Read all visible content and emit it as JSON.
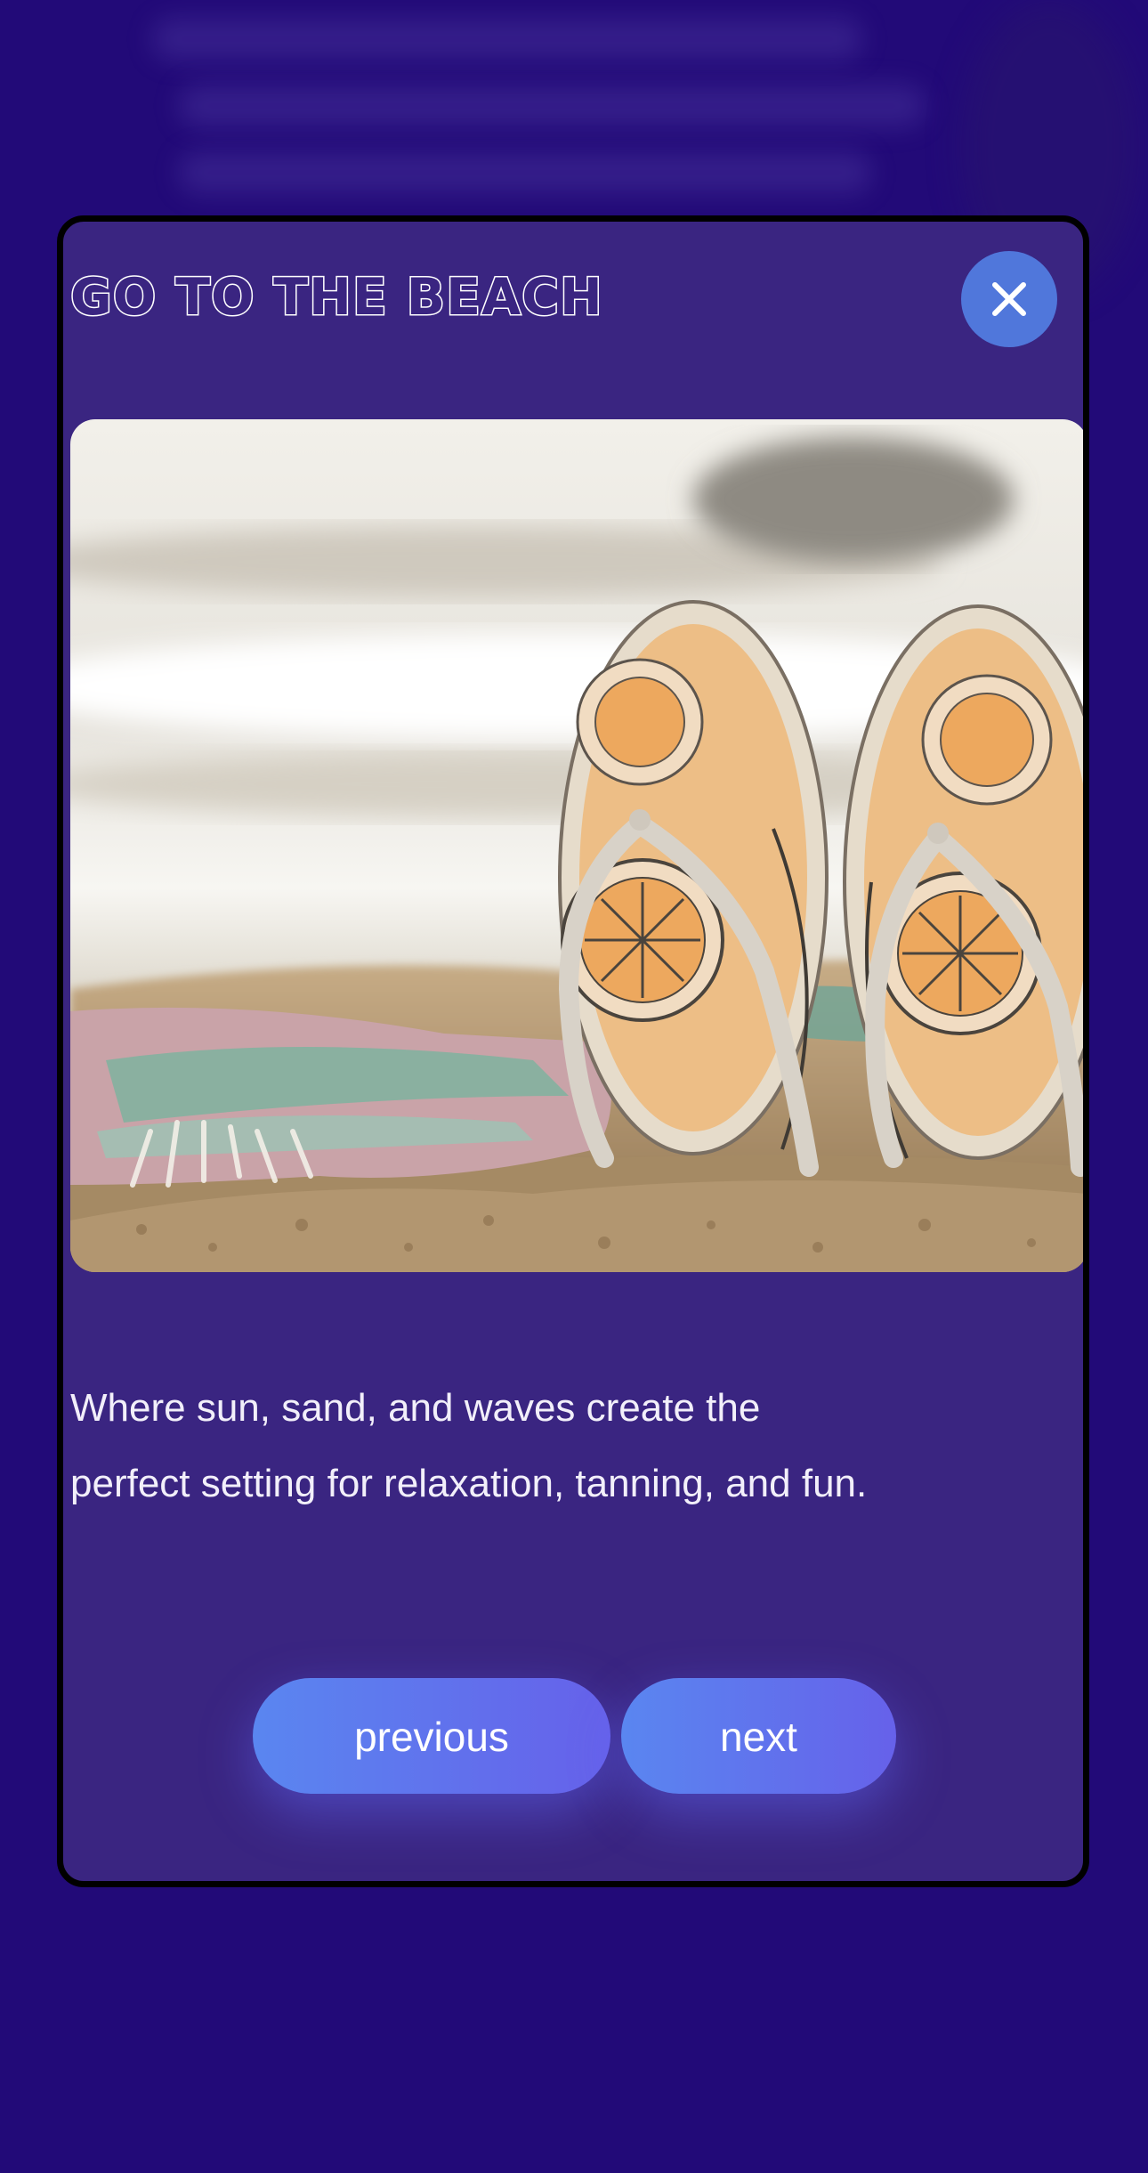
{
  "modal": {
    "title": "GO TO THE BEACH",
    "close_icon": "close-icon",
    "image_alt": "Flip-flops with orange slice print standing in beach sand beside a pink and teal striped towel",
    "description": "Where sun, sand, and waves create the perfect setting for relaxation, tanning, and fun.",
    "buttons": {
      "previous": "previous",
      "next": "next"
    }
  },
  "colors": {
    "page_background": "#220a78",
    "modal_background": "#3a2581",
    "close_button": "#5077db",
    "button_gradient_start": "#5a86f0",
    "button_gradient_end": "#6661ea"
  }
}
